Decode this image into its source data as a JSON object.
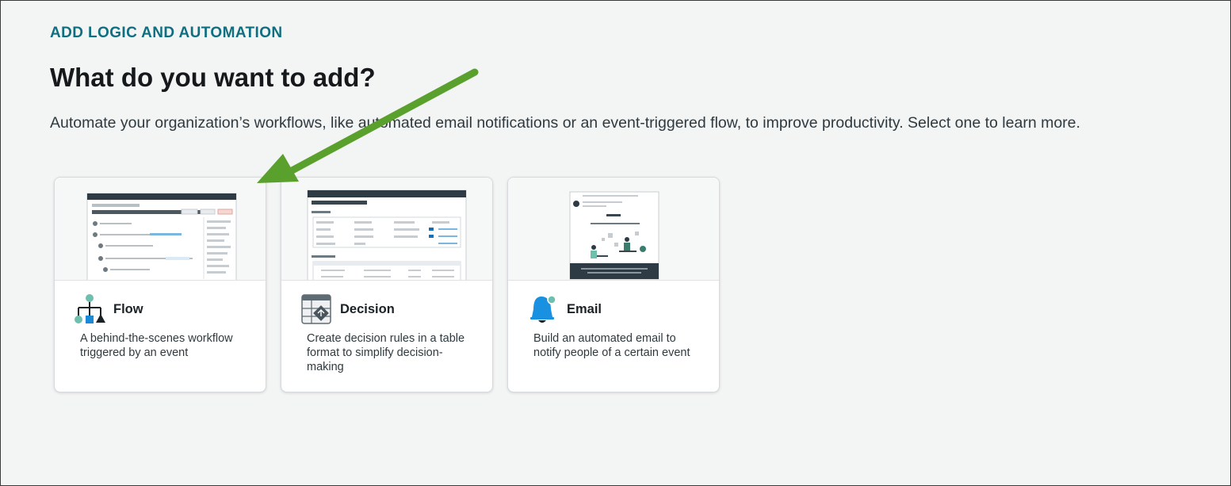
{
  "header": {
    "eyebrow": "ADD LOGIC AND AUTOMATION",
    "title": "What do you want to add?",
    "subtitle": "Automate your organization’s workflows, like automated email notifications or an event-triggered flow, to improve productivity. Select one to learn more."
  },
  "cards": [
    {
      "icon": "flow-icon",
      "title": "Flow",
      "description": "A behind-the-scenes workflow triggered by an event"
    },
    {
      "icon": "decision-icon",
      "title": "Decision",
      "description": "Create decision rules in a table format to simplify decision-making"
    },
    {
      "icon": "email-bell-icon",
      "title": "Email",
      "description": "Build an automated email to notify people of a certain event"
    }
  ],
  "colors": {
    "eyebrow": "#0e6f80",
    "arrow": "#5aa02c",
    "flow_icon_teal": "#6fbfae",
    "flow_icon_blue": "#1a8ad6",
    "email_icon_blue": "#1a90e0"
  }
}
